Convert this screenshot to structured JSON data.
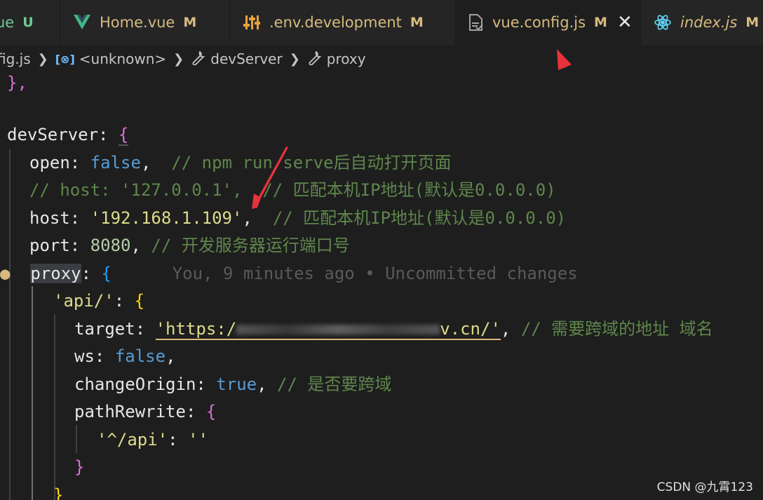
{
  "tabs": [
    {
      "label": "ue",
      "status": "U",
      "icon": "vue-icon"
    },
    {
      "label": "Home.vue",
      "status": "M",
      "icon": "vue-icon"
    },
    {
      "label": ".env.development",
      "status": "M",
      "icon": "settings-sliders-icon"
    },
    {
      "label": "vue.config.js",
      "status": "M",
      "icon": "file-js-icon",
      "active": true
    },
    {
      "label": "index.js",
      "status": "M",
      "icon": "react-icon"
    }
  ],
  "breadcrumb": {
    "file": "fig.js",
    "items": [
      "<unknown>",
      "devServer",
      "proxy"
    ]
  },
  "code": {
    "l0": "},",
    "l1_key": "devServer",
    "l2_key": "open",
    "l2_val": "false",
    "l2_com": "// npm run serve后自动打开页面",
    "l3_com": "// host: '127.0.0.1',  // 匹配本机IP地址(默认是0.0.0.0)",
    "l4_key": "host",
    "l4_val": "'192.168.1.109'",
    "l4_com": "// 匹配本机IP地址(默认是0.0.0.0)",
    "l5_key": "port",
    "l5_val": "8080",
    "l5_com": "// 开发服务器运行端口号",
    "l6_key": "proxy",
    "l6_blame": "You, 9 minutes ago • Uncommitted changes",
    "l7_key": "'api/'",
    "l8_key": "target",
    "l8_val_start": "'https:/",
    "l8_val_end": "v.cn/'",
    "l8_com": "// 需要跨域的地址 域名",
    "l9_key": "ws",
    "l9_val": "false",
    "l10_key": "changeOrigin",
    "l10_val": "true",
    "l10_com": "// 是否要跨域",
    "l11_key": "pathRewrite",
    "l12_key": "'^/api'",
    "l12_val": "''"
  },
  "watermark": "CSDN @九霄123",
  "colors": {
    "accent_arrow": "#e8323c",
    "modified": "#d7ba7d",
    "untracked": "#73c991"
  }
}
